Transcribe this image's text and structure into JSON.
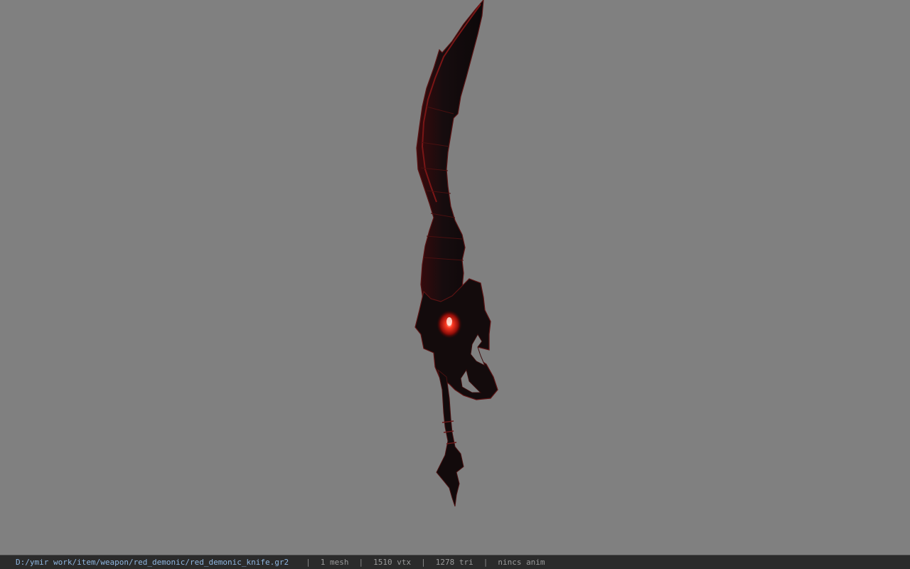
{
  "viewport": {
    "background_color": "#808080",
    "model_name": "red_demonic_knife",
    "model_colors": {
      "body": "#120c0d",
      "edge_highlight": "#6a1212",
      "gem": "#ff2a1a"
    }
  },
  "statusbar": {
    "file_path": "D:/ymir work/item/weapon/red_demonic/red_demonic_knife.gr2",
    "separator": "|",
    "mesh_count": "1 mesh",
    "vertex_count": "1510 vtx",
    "triangle_count": "1278 tri",
    "anim_status": "nincs anim"
  }
}
